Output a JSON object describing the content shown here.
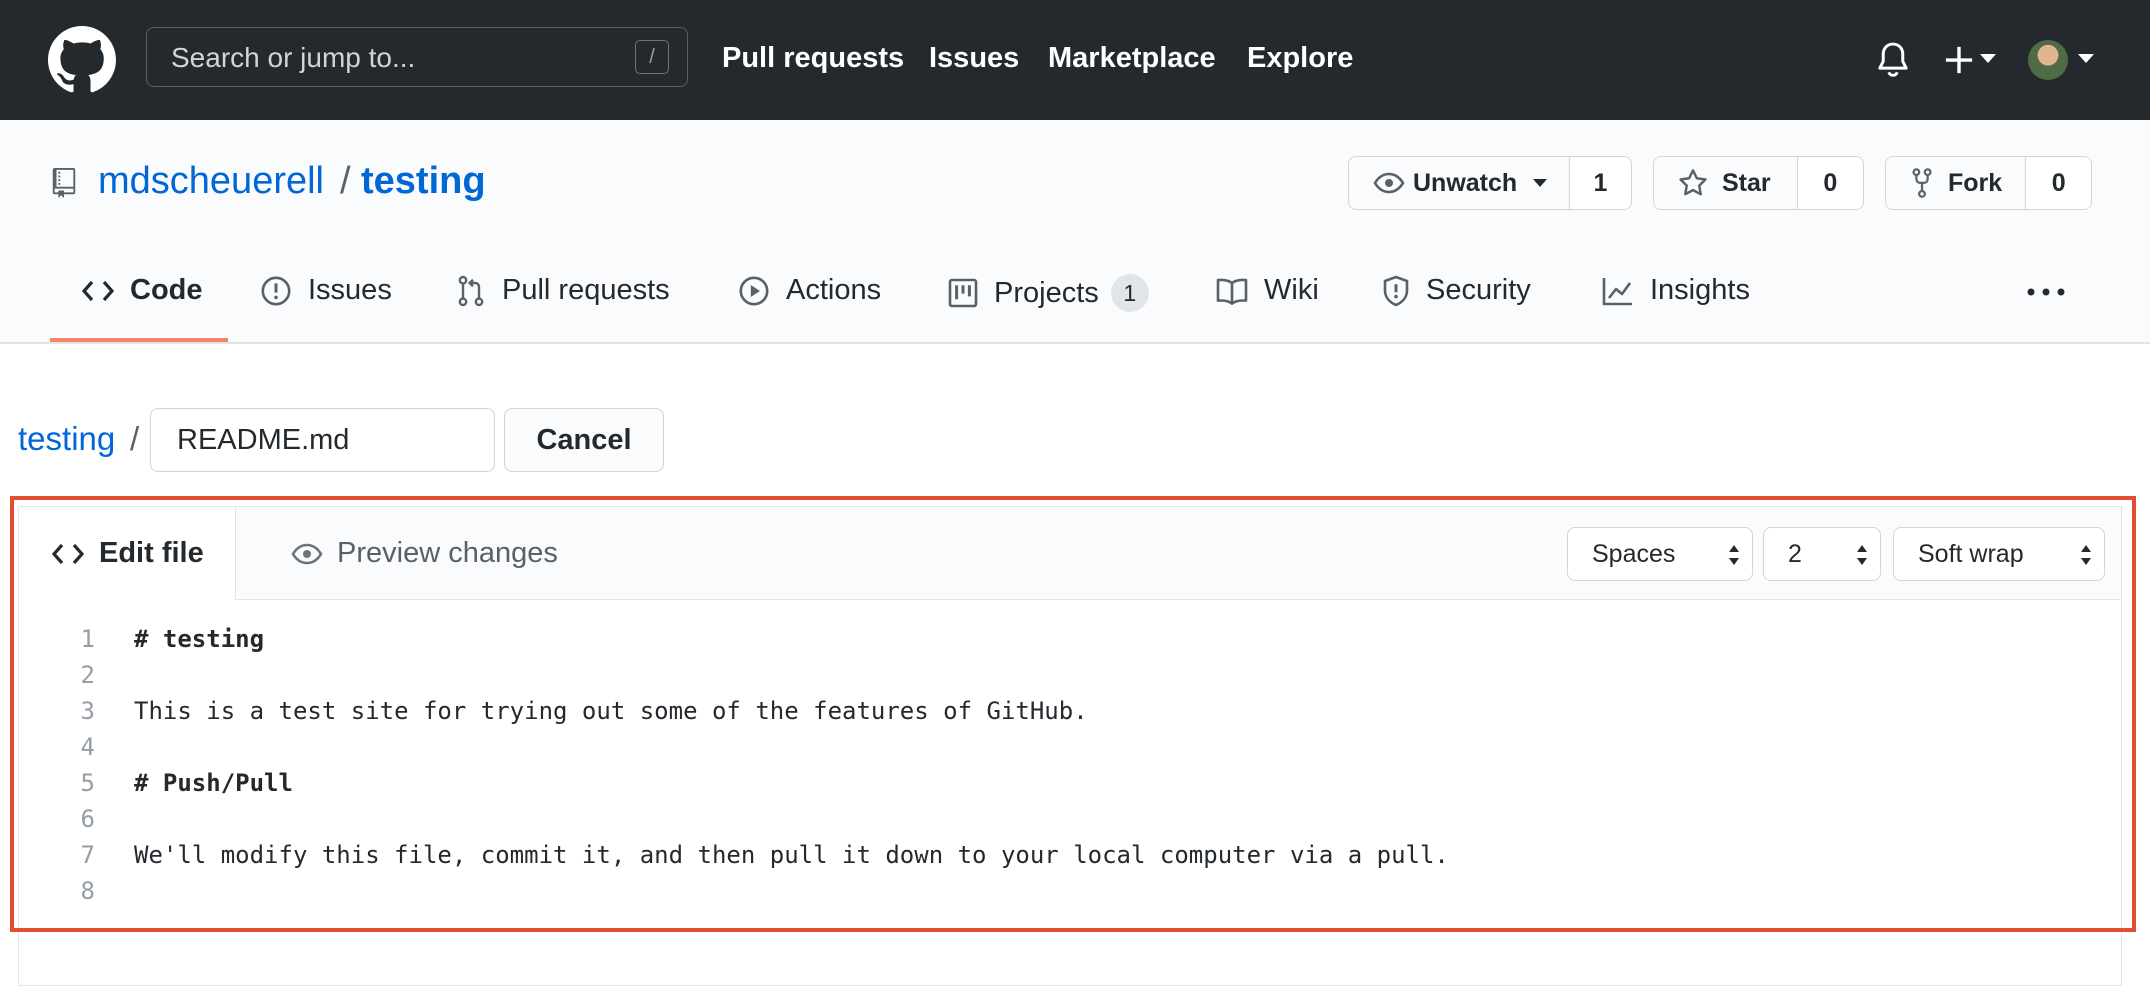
{
  "header": {
    "search_placeholder": "Search or jump to...",
    "search_shortcut": "/",
    "nav": [
      "Pull requests",
      "Issues",
      "Marketplace",
      "Explore"
    ]
  },
  "repo": {
    "owner": "mdscheuerell",
    "separator": "/",
    "name": "testing",
    "watch_label": "Unwatch",
    "watch_count": "1",
    "star_label": "Star",
    "star_count": "0",
    "fork_label": "Fork",
    "fork_count": "0"
  },
  "tabs": [
    {
      "label": "Code",
      "icon": "code-icon",
      "active": true
    },
    {
      "label": "Issues",
      "icon": "issue-icon"
    },
    {
      "label": "Pull requests",
      "icon": "pull-request-icon"
    },
    {
      "label": "Actions",
      "icon": "play-icon"
    },
    {
      "label": "Projects",
      "icon": "project-icon",
      "counter": "1"
    },
    {
      "label": "Wiki",
      "icon": "book-icon"
    },
    {
      "label": "Security",
      "icon": "shield-icon"
    },
    {
      "label": "Insights",
      "icon": "graph-icon"
    }
  ],
  "file": {
    "breadcrumb": "testing",
    "separator": "/",
    "filename": "README.md",
    "cancel_label": "Cancel"
  },
  "editor": {
    "edit_tab": "Edit file",
    "preview_tab": "Preview changes",
    "indent_mode": "Spaces",
    "indent_size": "2",
    "wrap_mode": "Soft wrap",
    "lines": [
      {
        "n": "1",
        "text": "# testing"
      },
      {
        "n": "2",
        "text": ""
      },
      {
        "n": "3",
        "text": "This is a test site for trying out some of the features of GitHub."
      },
      {
        "n": "4",
        "text": ""
      },
      {
        "n": "5",
        "text": "# Push/Pull"
      },
      {
        "n": "6",
        "text": ""
      },
      {
        "n": "7",
        "text": "We'll modify this file, commit it, and then pull it down to your local computer via a pull."
      },
      {
        "n": "8",
        "text": ""
      }
    ]
  },
  "colors": {
    "header_bg": "#24292e",
    "link": "#0366d6",
    "active_tab_underline": "#f9826c",
    "highlight_border": "#e34d33"
  }
}
